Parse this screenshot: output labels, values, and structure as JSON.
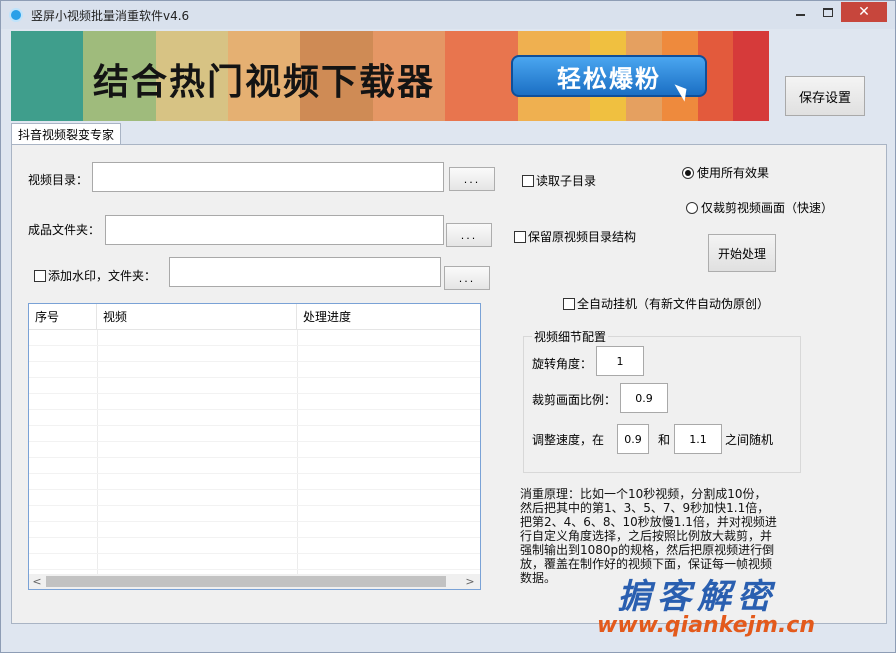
{
  "window": {
    "title": "竖屏小视频批量消重软件v4.6",
    "close_label": "✕"
  },
  "banner": {
    "headline": "结合热门视频下载器",
    "button_label": "轻松爆粉",
    "stripe_colors": [
      "#3f9e8c",
      "#9fbb7c",
      "#d7c384",
      "#e5b072",
      "#cf8b55",
      "#e59765",
      "#e8754e",
      "#efb050",
      "#f0c040",
      "#e5a060",
      "#ee8a3d",
      "#e35a3c",
      "#d63a3a"
    ]
  },
  "toolbar": {
    "save_label": "保存设置"
  },
  "tab": {
    "label": "抖音视频裂变专家"
  },
  "form": {
    "video_dir_label": "视频目录：",
    "output_dir_label": "成品文件夹：",
    "watermark_label": "添加水印，文件夹：",
    "browse_label": "...",
    "read_subdir_label": "读取子目录",
    "keep_structure_label": "保留原视频目录结构",
    "use_all_effects_label": "使用所有效果",
    "crop_only_label": "仅裁剪视频画面（快速）",
    "start_label": "开始处理",
    "auto_hang_label": "全自动挂机（有新文件自动伪原创）"
  },
  "table": {
    "columns": [
      "序号",
      "视频",
      "处理进度"
    ],
    "scroll_left": "<",
    "scroll_right": ">"
  },
  "config": {
    "group_title": "视频细节配置",
    "rotate_label": "旋转角度：",
    "rotate_value": "1",
    "crop_label": "裁剪画面比例：",
    "crop_value": "0.9",
    "speed_label": "调整速度，在",
    "speed_min": "0.9",
    "and_label": "和",
    "speed_max": "1.1",
    "random_label": "之间随机"
  },
  "description": "消重原理：比如一个10秒视频，分割成10份，然后把其中的第1、3、5、7、9秒加快1.1倍，把第2、4、6、8、10秒放慢1.1倍，并对视频进行自定义角度选择，之后按照比例放大裁剪，并强制输出到1080p的规格，然后把原视频进行倒放，覆盖在制作好的视频下面，保证每一帧视频数据。",
  "watermark": {
    "brand": "掮客解密",
    "url": "www.qiankejm.cn"
  }
}
